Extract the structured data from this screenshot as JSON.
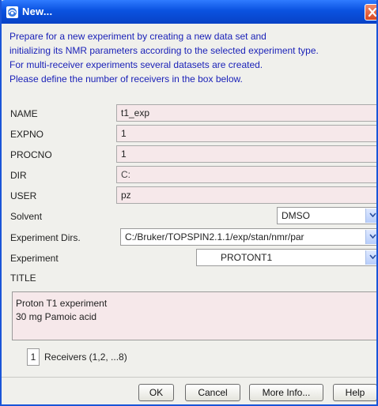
{
  "window": {
    "title": "New..."
  },
  "intro": {
    "lines": [
      "Prepare for a new experiment by creating a new data set and",
      "initializing its NMR parameters according to the selected experiment type.",
      "For multi-receiver experiments several datasets are created.",
      "Please define the number of receivers in the box below."
    ]
  },
  "fields": {
    "name": {
      "label": "NAME",
      "value": "t1_exp"
    },
    "expno": {
      "label": "EXPNO",
      "value": "1"
    },
    "procno": {
      "label": "PROCNO",
      "value": "1"
    },
    "dir": {
      "label": "DIR",
      "value": "C:"
    },
    "user": {
      "label": "USER",
      "value": "pz"
    }
  },
  "solvent": {
    "label": "Solvent",
    "value": "DMSO"
  },
  "exp_dirs": {
    "label": "Experiment Dirs.",
    "value": "C:/Bruker/TOPSPIN2.1.1/exp/stan/nmr/par"
  },
  "experiment": {
    "label": "Experiment",
    "value": "PROTONT1"
  },
  "title_section": {
    "label": "TITLE",
    "lines": [
      "Proton T1 experiment",
      "30 mg Pamoic acid"
    ]
  },
  "receivers": {
    "value": "1",
    "label": "Receivers (1,2, ...8)"
  },
  "buttons": {
    "ok": "OK",
    "cancel": "Cancel",
    "more_info": "More Info...",
    "help": "Help"
  }
}
